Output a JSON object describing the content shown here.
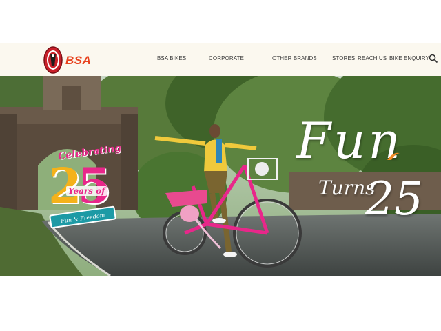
{
  "brand": {
    "name": "BSA",
    "accent": "#e8431f"
  },
  "nav": {
    "items": [
      {
        "label": "BSA BIKES"
      },
      {
        "label": "CORPORATE"
      },
      {
        "label": "OTHER BRANDS"
      },
      {
        "label": "STORES"
      },
      {
        "label": "REACH US"
      },
      {
        "label": "BIKE ENQUIRY"
      }
    ],
    "search_icon": "search-icon"
  },
  "hero": {
    "celebrating": "Celebrating",
    "number": {
      "two": "2",
      "five": "5"
    },
    "years_of": "Years of",
    "ribbon": "Fun & Freedom",
    "fun": "Fun",
    "turns": "Turns",
    "turns_number": "25",
    "colors": {
      "pink": "#e8278a",
      "yellow": "#f4b21a",
      "teal": "#1d9aa5"
    }
  }
}
